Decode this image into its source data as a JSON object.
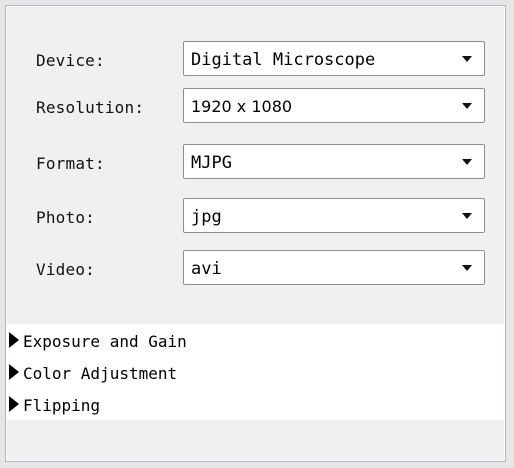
{
  "settings": [
    {
      "label": "Device:",
      "value": "Digital Microscope"
    },
    {
      "label": "Resolution:",
      "value": "1920 x 1080"
    },
    {
      "label": "Format:",
      "value": "MJPG"
    },
    {
      "label": "Photo:",
      "value": "jpg"
    },
    {
      "label": "Video:",
      "value": "avi"
    }
  ],
  "sections": [
    {
      "label": "Exposure and Gain"
    },
    {
      "label": "Color Adjustment"
    },
    {
      "label": "Flipping"
    }
  ],
  "icons": {
    "dropdown": "chevron-down-icon",
    "collapsed": "triangle-right-icon"
  },
  "colors": {
    "panel_bg": "#f0f0f0",
    "section_bg": "#ffffff",
    "border": "#a9b6c8"
  }
}
